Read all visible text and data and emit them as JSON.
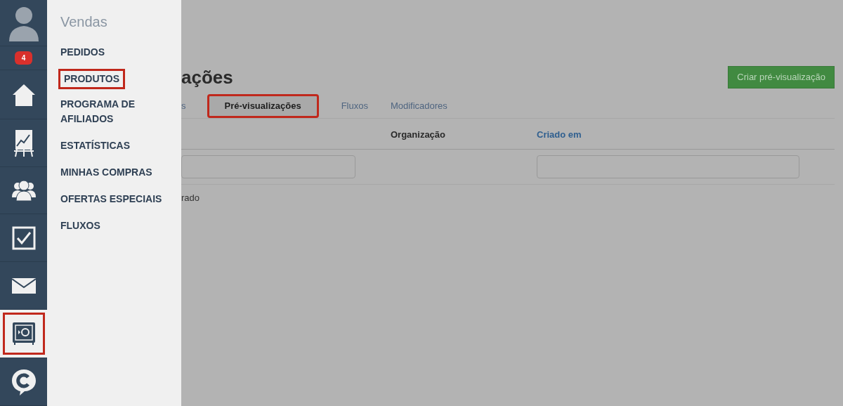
{
  "sidebar": {
    "items": [
      {
        "kind": "avatar",
        "selected": false,
        "highlighted": false
      },
      {
        "kind": "badge",
        "text": "4"
      },
      {
        "kind": "home",
        "selected": false,
        "highlighted": false
      },
      {
        "kind": "chart",
        "selected": false,
        "highlighted": false
      },
      {
        "kind": "people",
        "selected": false,
        "highlighted": false
      },
      {
        "kind": "tasks",
        "selected": false,
        "highlighted": false
      },
      {
        "kind": "mail",
        "selected": false,
        "highlighted": false
      },
      {
        "kind": "safe",
        "selected": true,
        "highlighted": true
      },
      {
        "kind": "chat",
        "selected": false,
        "highlighted": false
      }
    ]
  },
  "flyout": {
    "title": "Vendas",
    "items": [
      {
        "label": "PEDIDOS",
        "highlighted": false
      },
      {
        "label": "PRODUTOS",
        "highlighted": true
      },
      {
        "label": "PROGRAMA DE AFILIADOS",
        "highlighted": false
      },
      {
        "label": "ESTATÍSTICAS",
        "highlighted": false
      },
      {
        "label": "MINHAS COMPRAS",
        "highlighted": false
      },
      {
        "label": "OFERTAS ESPECIAIS",
        "highlighted": false
      },
      {
        "label": "FLUXOS",
        "highlighted": false
      }
    ]
  },
  "page": {
    "title": "ações",
    "create_button": "Criar pré-visualização",
    "tabs": [
      {
        "label": "s",
        "selected": false,
        "highlighted": false
      },
      {
        "label": "Pré-visualizações",
        "selected": true,
        "highlighted": true
      },
      {
        "label": "Fluxos",
        "selected": false,
        "highlighted": false
      },
      {
        "label": "Modificadores",
        "selected": false,
        "highlighted": false
      }
    ],
    "table": {
      "columns": [
        {
          "has_filter": true
        },
        {
          "label": "Organização",
          "link": false,
          "has_filter": false
        },
        {
          "label": "Criado em",
          "link": true,
          "has_filter": true
        }
      ],
      "empty_text": "rado"
    }
  }
}
